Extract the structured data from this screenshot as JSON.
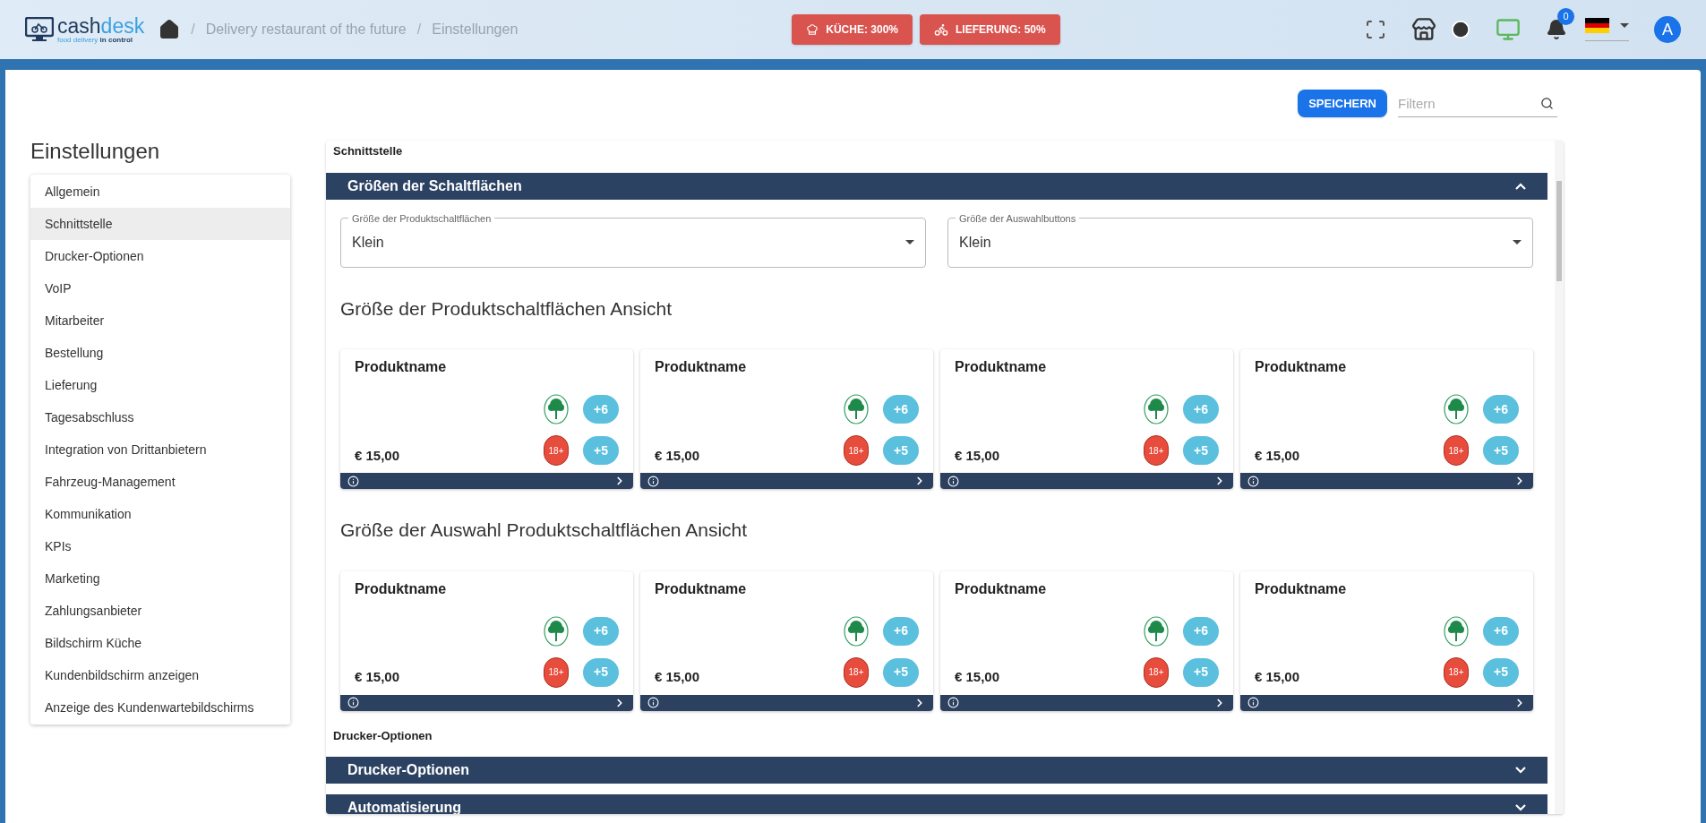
{
  "header": {
    "logo": {
      "word_1": "cash",
      "word_2": "desk",
      "tagline_1": "food delivery",
      "tagline_2": "in control"
    },
    "breadcrumbs": [
      {
        "separator": "/",
        "label": "Delivery restaurant of the future"
      },
      {
        "separator": "/",
        "label": "Einstellungen"
      }
    ],
    "status_buttons": [
      {
        "kind": "kitchen",
        "label": "KÜCHE: 300%"
      },
      {
        "kind": "delivery",
        "label": "LIEFERUNG: 50%"
      }
    ],
    "notifications": "0",
    "avatar": "A"
  },
  "toolbar": {
    "save": "SPEICHERN",
    "filter": {
      "placeholder": "Filtern"
    }
  },
  "sidebar": {
    "title": "Einstellungen",
    "items": [
      {
        "label": "Allgemein",
        "selected": false
      },
      {
        "label": "Schnittstelle",
        "selected": true
      },
      {
        "label": "Drucker-Optionen",
        "selected": false
      },
      {
        "label": "VoIP",
        "selected": false
      },
      {
        "label": "Mitarbeiter",
        "selected": false
      },
      {
        "label": "Bestellung",
        "selected": false
      },
      {
        "label": "Lieferung",
        "selected": false
      },
      {
        "label": "Tagesabschluss",
        "selected": false
      },
      {
        "label": "Integration von Drittanbietern",
        "selected": false
      },
      {
        "label": "Fahrzeug-Management",
        "selected": false
      },
      {
        "label": "Kommunikation",
        "selected": false
      },
      {
        "label": "KPIs",
        "selected": false
      },
      {
        "label": "Marketing",
        "selected": false
      },
      {
        "label": "Zahlungsanbieter",
        "selected": false
      },
      {
        "label": "Bildschirm Küche",
        "selected": false
      },
      {
        "label": "Kundenbildschirm anzeigen",
        "selected": false
      },
      {
        "label": "Anzeige des Kundenwartebildschirms",
        "selected": false
      }
    ]
  },
  "sections": [
    {
      "label": "Schnittstelle",
      "panels": [
        {
          "title": "Größen der Schaltflächen",
          "expanded": true,
          "selects": [
            {
              "label": "Größe der Produktschaltflächen",
              "value": "Klein"
            },
            {
              "label": "Größe der Auswahlbuttons",
              "value": "Klein"
            }
          ],
          "previews": [
            {
              "title": "Größe der Produktschaltflächen Ansicht",
              "cards": [
                {
                  "name": "Produktname",
                  "price": "€ 15,00",
                  "age": "18+",
                  "count_1": "+6",
                  "count_2": "+5"
                },
                {
                  "name": "Produktname",
                  "price": "€ 15,00",
                  "age": "18+",
                  "count_1": "+6",
                  "count_2": "+5"
                },
                {
                  "name": "Produktname",
                  "price": "€ 15,00",
                  "age": "18+",
                  "count_1": "+6",
                  "count_2": "+5"
                },
                {
                  "name": "Produktname",
                  "price": "€ 15,00",
                  "age": "18+",
                  "count_1": "+6",
                  "count_2": "+5"
                }
              ]
            },
            {
              "title": "Größe der Auswahl Produktschaltflächen Ansicht",
              "cards": [
                {
                  "name": "Produktname",
                  "price": "€ 15,00",
                  "age": "18+",
                  "count_1": "+6",
                  "count_2": "+5"
                },
                {
                  "name": "Produktname",
                  "price": "€ 15,00",
                  "age": "18+",
                  "count_1": "+6",
                  "count_2": "+5"
                },
                {
                  "name": "Produktname",
                  "price": "€ 15,00",
                  "age": "18+",
                  "count_1": "+6",
                  "count_2": "+5"
                },
                {
                  "name": "Produktname",
                  "price": "€ 15,00",
                  "age": "18+",
                  "count_1": "+6",
                  "count_2": "+5"
                }
              ]
            }
          ]
        }
      ]
    },
    {
      "label": "Drucker-Optionen",
      "panels": [
        {
          "title": "Drucker-Optionen",
          "expanded": false
        },
        {
          "title": "Automatisierung",
          "expanded": false
        }
      ]
    }
  ]
}
